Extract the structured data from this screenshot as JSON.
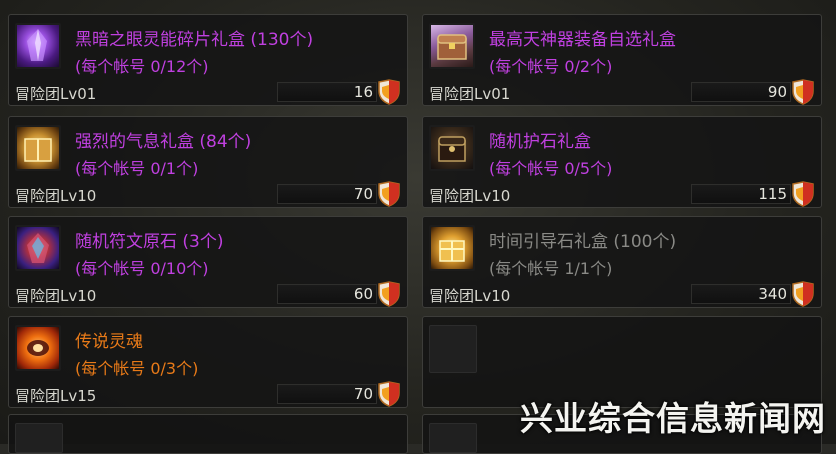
{
  "items": [
    {
      "name": "黑暗之眼灵能碎片礼盒 (130个)",
      "limit": "(每个帐号 0/12个)",
      "level": "冒险团Lv01",
      "price": "16",
      "color": "purple",
      "icon": "purple-crystal-icon"
    },
    {
      "name": "最高天神器装备自选礼盒",
      "limit": "(每个帐号 0/2个)",
      "level": "冒险团Lv01",
      "price": "90",
      "color": "purple",
      "icon": "treasure-chest-icon"
    },
    {
      "name": "强烈的气息礼盒 (84个)",
      "limit": "(每个帐号 0/1个)",
      "level": "冒险团Lv10",
      "price": "70",
      "color": "purple",
      "icon": "golden-box-icon"
    },
    {
      "name": "随机护石礼盒",
      "limit": "(每个帐号 0/5个)",
      "level": "冒险团Lv10",
      "price": "115",
      "color": "purple",
      "icon": "dark-chest-icon"
    },
    {
      "name": "随机符文原石 (3个)",
      "limit": "(每个帐号 0/10个)",
      "level": "冒险团Lv10",
      "price": "60",
      "color": "purple",
      "icon": "rune-stone-icon"
    },
    {
      "name": "时间引导石礼盒 (100个)",
      "limit": "(每个帐号 1/1个)",
      "level": "冒险团Lv10",
      "price": "340",
      "color": "gray",
      "icon": "golden-gift-icon"
    },
    {
      "name": "传说灵魂",
      "limit": "(每个帐号 0/3个)",
      "level": "冒险团Lv15",
      "price": "70",
      "color": "orange",
      "icon": "legendary-soul-icon"
    }
  ],
  "currency_icon": "shield-currency-icon",
  "watermark": "兴业综合信息新闻网"
}
